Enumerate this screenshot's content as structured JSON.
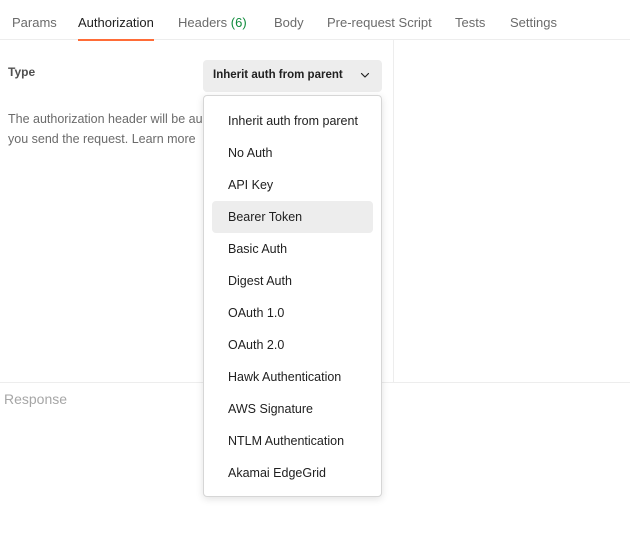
{
  "tabs": [
    {
      "label": "Params"
    },
    {
      "label": "Authorization",
      "active": true
    },
    {
      "label": "Headers",
      "count": "(6)"
    },
    {
      "label": "Body"
    },
    {
      "label": "Pre-request Script"
    },
    {
      "label": "Tests"
    },
    {
      "label": "Settings"
    }
  ],
  "auth": {
    "type_label": "Type",
    "selected": "Inherit auth from parent",
    "description_line1": "The authorization header will be au",
    "description_line2": "you send the request. Learn more"
  },
  "response": {
    "title": "Response"
  },
  "dropdown": {
    "items": [
      {
        "label": "Inherit auth from parent"
      },
      {
        "label": "No Auth"
      },
      {
        "label": "API Key"
      },
      {
        "label": "Bearer Token",
        "hovered": true
      },
      {
        "label": "Basic Auth"
      },
      {
        "label": "Digest Auth"
      },
      {
        "label": "OAuth 1.0"
      },
      {
        "label": "OAuth 2.0"
      },
      {
        "label": "Hawk Authentication"
      },
      {
        "label": "AWS Signature"
      },
      {
        "label": "NTLM Authentication"
      },
      {
        "label": "Akamai EdgeGrid"
      }
    ]
  },
  "icons": {
    "select_chevron": "chevron-down-icon"
  },
  "colors": {
    "active_tab_underline": "#ff6c37",
    "headers_count": "#0f8b3c",
    "hover_bg": "#ededed"
  }
}
